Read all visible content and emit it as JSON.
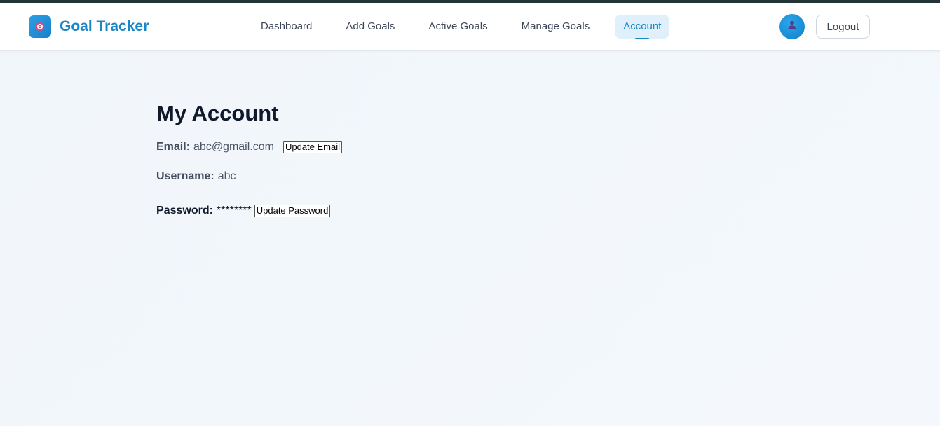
{
  "app": {
    "title": "Goal Tracker",
    "brand_icon": "target-icon",
    "accent_color": "#1a86c6"
  },
  "nav": {
    "items": [
      {
        "label": "Dashboard",
        "active": false
      },
      {
        "label": "Add Goals",
        "active": false
      },
      {
        "label": "Active Goals",
        "active": false
      },
      {
        "label": "Manage Goals",
        "active": false
      },
      {
        "label": "Account",
        "active": true
      }
    ]
  },
  "header": {
    "avatar_icon": "user-icon",
    "logout_label": "Logout"
  },
  "account": {
    "heading": "My Account",
    "email_label": "Email:",
    "email_value": "abc@gmail.com",
    "update_email_label": "Update Email",
    "username_label": "Username:",
    "username_value": "abc",
    "password_label": "Password:",
    "password_value": "********",
    "update_password_label": "Update Password"
  }
}
